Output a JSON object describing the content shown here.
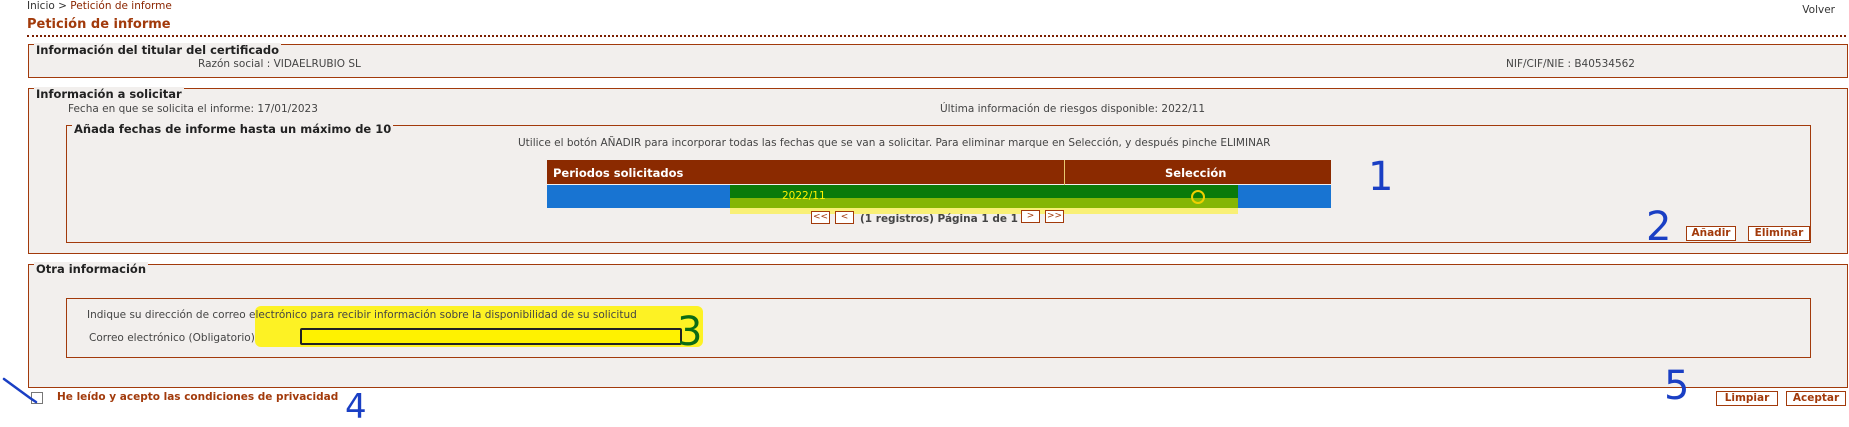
{
  "breadcrumb": {
    "home": "Inicio",
    "separator": " > ",
    "current": "Petición de informe"
  },
  "header": {
    "back_label": "Volver",
    "title": "Petición de informe"
  },
  "holder": {
    "legend": "Información del titular del certificado",
    "razon_label": "Razón social :",
    "razon_value": "VIDAELRUBIO SL",
    "nif_label": "NIF/CIF/NIE :",
    "nif_value": "B40534562"
  },
  "request": {
    "legend": "Información a solicitar",
    "date_label": "Fecha en que se solicita el informe:",
    "date_value": "17/01/2023",
    "last_label": "Última información de riesgos disponible:",
    "last_value": "2022/11",
    "dates_legend": "Añada fechas de informe hasta un máximo de 10",
    "instructions": "Utilice el botón AÑADIR para incorporar todas las fechas que se van a solicitar. Para eliminar marque en Selección, y después pinche ELIMINAR",
    "table": {
      "col_periods": "Periodos solicitados",
      "col_selection": "Selección",
      "rows": [
        {
          "period": "2022/11",
          "selected": false
        }
      ]
    },
    "pagination": {
      "first": "<<",
      "prev": "<",
      "next": ">",
      "last": ">>",
      "info": "(1 registros) Página 1 de 1"
    },
    "add_label": "Añadir",
    "delete_label": "Eliminar"
  },
  "other": {
    "legend": "Otra información",
    "email_hint": "Indique su dirección de correo electrónico para recibir información sobre la disponibilidad de su solicitud",
    "email_label": "Correo electrónico",
    "email_required": "(Obligatorio)",
    "email_value": ""
  },
  "privacy": {
    "label": "He leído y acepto las condiciones de privacidad",
    "checked": false
  },
  "actions": {
    "clear_label": "Limpiar",
    "accept_label": "Aceptar"
  },
  "annotations": [
    "1",
    "2",
    "3",
    "4",
    "5"
  ],
  "colors": {
    "accent": "#a23a0b",
    "table_header": "#8b2a00",
    "row_blue": "#1874d2",
    "row_green": "#0a7a0a",
    "highlight": "#fff200",
    "annotation_blue": "#1a3fc4",
    "annotation_green": "#0b6b14"
  }
}
